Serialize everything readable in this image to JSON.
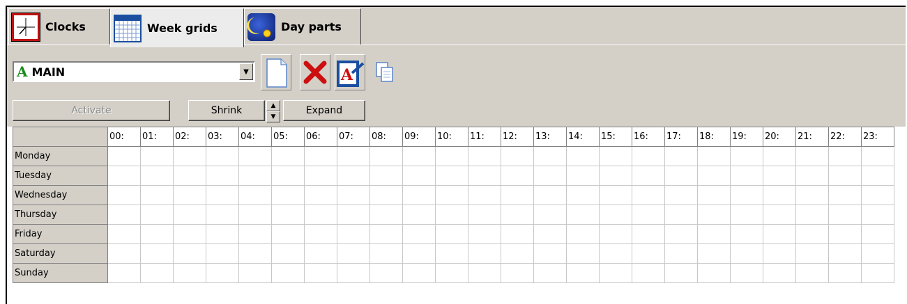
{
  "tabs": [
    {
      "label": "Clocks",
      "icon": "clock-icon",
      "active": false
    },
    {
      "label": "Week grids",
      "icon": "calendar-grid-icon",
      "active": true
    },
    {
      "label": "Day parts",
      "icon": "moon-sun-icon",
      "active": false
    }
  ],
  "selector": {
    "glyph": "A",
    "value": "MAIN"
  },
  "toolbar": {
    "new": "new-document-icon",
    "delete": "delete-icon",
    "rename": "rename-icon",
    "copy": "copy-icon"
  },
  "actions": {
    "activate": "Activate",
    "shrink": "Shrink",
    "expand": "Expand"
  },
  "grid": {
    "hours": [
      "00:",
      "01:",
      "02:",
      "03:",
      "04:",
      "05:",
      "06:",
      "07:",
      "08:",
      "09:",
      "10:",
      "11:",
      "12:",
      "13:",
      "14:",
      "15:",
      "16:",
      "17:",
      "18:",
      "19:",
      "20:",
      "21:",
      "22:",
      "23:"
    ],
    "days": [
      "Monday",
      "Tuesday",
      "Wednesday",
      "Thursday",
      "Friday",
      "Saturday",
      "Sunday"
    ]
  },
  "colors": {
    "panel": "#d4d0c8",
    "accent_green": "#1a8a1a",
    "delete_red": "#cc1010",
    "tab_blue": "#1a4fa0"
  }
}
